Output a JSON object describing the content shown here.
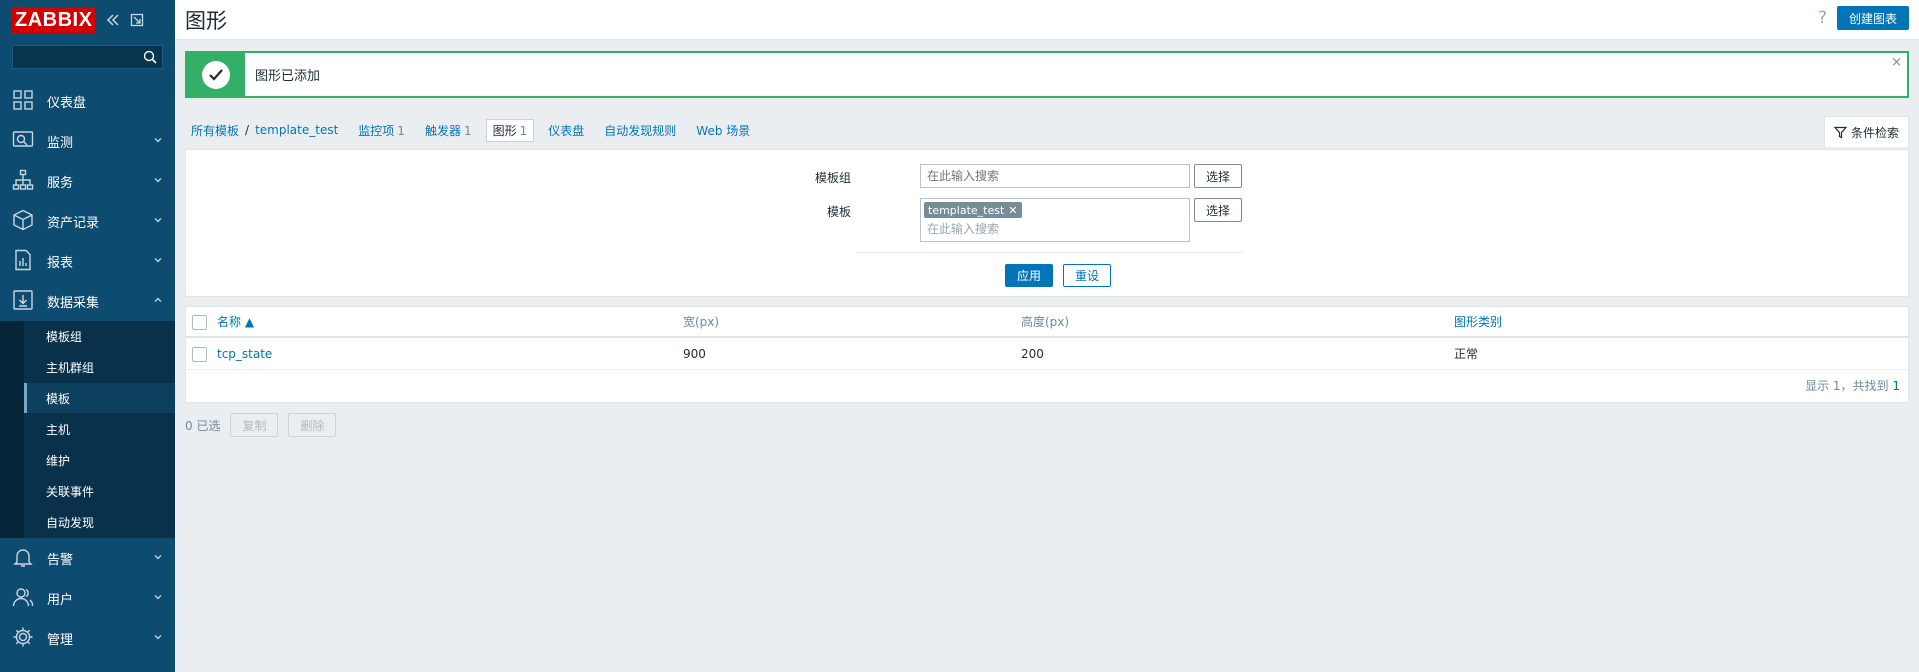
{
  "sidebar": {
    "logo": "ZABBIX",
    "search": {
      "value": "",
      "placeholder": ""
    },
    "menu": [
      {
        "label": "仪表盘",
        "icon": "dashboard-icon"
      },
      {
        "label": "监测",
        "icon": "monitoring-icon"
      },
      {
        "label": "服务",
        "icon": "services-icon"
      },
      {
        "label": "资产记录",
        "icon": "inventory-icon"
      },
      {
        "label": "报表",
        "icon": "reports-icon"
      },
      {
        "label": "数据采集",
        "icon": "data-collection-icon",
        "expanded": true
      },
      {
        "label": "告警",
        "icon": "alerts-icon"
      },
      {
        "label": "用户",
        "icon": "users-icon"
      },
      {
        "label": "管理",
        "icon": "administration-icon"
      }
    ],
    "submenu": [
      {
        "label": "模板组"
      },
      {
        "label": "主机群组"
      },
      {
        "label": "模板",
        "active": true
      },
      {
        "label": "主机"
      },
      {
        "label": "维护"
      },
      {
        "label": "关联事件"
      },
      {
        "label": "自动发现"
      }
    ]
  },
  "header": {
    "title": "图形",
    "help": "?",
    "create_button": "创建图表"
  },
  "message": {
    "text": "图形已添加",
    "close": "×"
  },
  "nav": {
    "crumbs": [
      "所有模板",
      "/",
      "template_test"
    ],
    "tabs": [
      {
        "label": "监控项",
        "count": "1"
      },
      {
        "label": "触发器",
        "count": "1"
      },
      {
        "label": "图形",
        "count": "1",
        "selected": true
      },
      {
        "label": "仪表盘",
        "count": ""
      },
      {
        "label": "自动发现规则",
        "count": ""
      },
      {
        "label": "Web 场景",
        "count": ""
      }
    ],
    "filter_tab": "条件检索"
  },
  "filter": {
    "template_group_label": "模板组",
    "template_group_placeholder": "在此输入搜索",
    "template_label": "模板",
    "template_chip": "template_test",
    "template_placeholder": "在此输入搜索",
    "select_button": "选择",
    "apply_button": "应用",
    "reset_button": "重设"
  },
  "table": {
    "columns": [
      "名称 ▲",
      "宽(px)",
      "高度(px)",
      "图形类别"
    ],
    "rows": [
      [
        "tcp_state",
        "900",
        "200",
        "正常"
      ]
    ],
    "footer_prefix": "显示 1，共找到",
    "footer_total": "1"
  },
  "actions": {
    "selected": "0 已选",
    "copy": "复制",
    "delete": "删除"
  },
  "colors": {
    "sidebar": "#0e4b71",
    "accent": "#0275b8",
    "success": "#34af67",
    "logo": "#d40000"
  }
}
